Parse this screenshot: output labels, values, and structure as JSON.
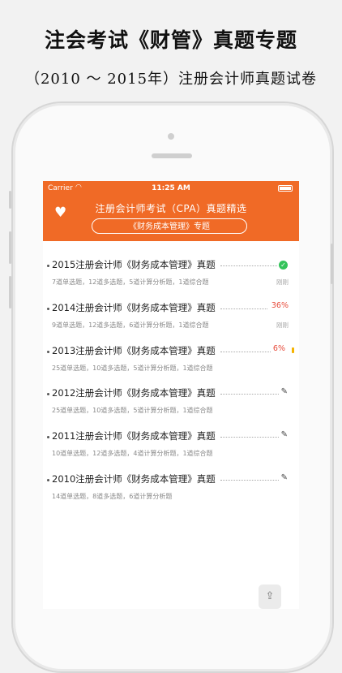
{
  "promo": {
    "headline": "注会考试《财管》真题专题",
    "subline": "（2010 ～ 2015年）注册会计师真题试卷"
  },
  "status_bar": {
    "carrier": "Carrier",
    "time": "11:25 AM"
  },
  "header": {
    "title": "注册会计师考试（CPA）真题精选",
    "subject_pill": "《财务成本管理》专题"
  },
  "exams": [
    {
      "title": "2015注册会计师《财务成本管理》真题",
      "desc": "7道单选题，12道多选题，5道计算分析题，1道综合题",
      "status": "completed",
      "progress": "",
      "time": "刚刚"
    },
    {
      "title": "2014注册会计师《财务成本管理》真题",
      "desc": "9道单选题，12道多选题，6道计算分析题，1道综合题",
      "status": "in-progress",
      "progress": "36%",
      "time": "刚刚"
    },
    {
      "title": "2013注册会计师《财务成本管理》真题",
      "desc": "25道单选题，10道多选题，5道计算分析题，1道综合题",
      "status": "in-progress",
      "progress": "6%",
      "time": ""
    },
    {
      "title": "2012注册会计师《财务成本管理》真题",
      "desc": "25道单选题，10道多选题，5道计算分析题，1道综合题",
      "status": "not-started",
      "progress": "",
      "time": ""
    },
    {
      "title": "2011注册会计师《财务成本管理》真题",
      "desc": "10道单选题，12道多选题，4道计算分析题，1道综合题",
      "status": "not-started",
      "progress": "",
      "time": ""
    },
    {
      "title": "2010注册会计师《财务成本管理》真题",
      "desc": "14道单选题，8道多选题，6道计算分析题",
      "status": "not-started",
      "progress": "",
      "time": ""
    }
  ],
  "colors": {
    "accent": "#f06a26",
    "progress_text": "#e74c3c",
    "completed": "#33c35a"
  },
  "icons": {
    "favorite": "heart-icon",
    "completed": "check-circle-icon",
    "edit": "pencil-icon",
    "share": "share-icon"
  }
}
